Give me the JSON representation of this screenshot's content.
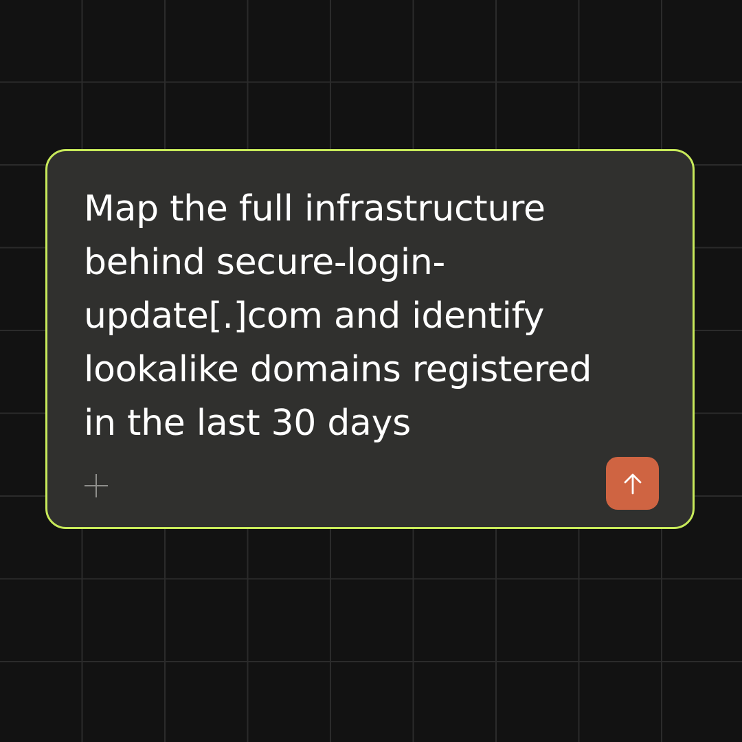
{
  "prompt": {
    "text": "Map the full infrastructure\nbehind secure-login-\nupdate[.]com and identify\nlookalike domains registered\nin the last 30 days"
  },
  "actions": {
    "attach_icon": "plus-icon",
    "send_icon": "arrow-up-icon"
  },
  "colors": {
    "background": "#121212",
    "grid_line": "#2b2b2b",
    "card_background": "#30302e",
    "card_border": "#c8ea5a",
    "send_button": "#cf6442",
    "text": "#ffffff"
  }
}
